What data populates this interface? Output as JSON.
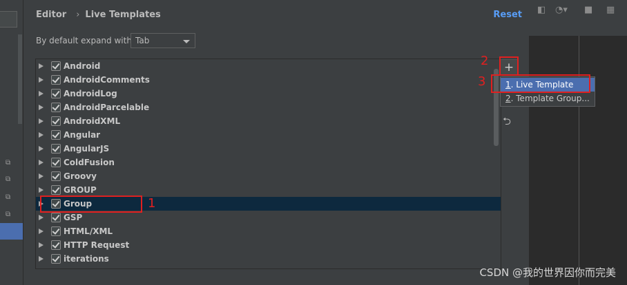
{
  "dialog": {
    "breadcrumb": [
      "Editor",
      "Live Templates"
    ],
    "reset_label": "Reset",
    "expand_label": "By default expand with",
    "expand_value": "Tab"
  },
  "groups": [
    "Android",
    "AndroidComments",
    "AndroidLog",
    "AndroidParcelable",
    "AndroidXML",
    "Angular",
    "AngularJS",
    "ColdFusion",
    "Groovy",
    "GROUP",
    "Group",
    "GSP",
    "HTML/XML",
    "HTTP Request",
    "iterations"
  ],
  "selected_group": "Group",
  "toolbar": {
    "add_icon": "plus-icon",
    "undo_icon": "undo-icon"
  },
  "add_menu": {
    "items": [
      "1. Live Template",
      "2. Template Group..."
    ],
    "highlighted_index": 0
  },
  "annotations": [
    "1",
    "2",
    "3"
  ],
  "watermark": "CSDN @我的世界因你而完美",
  "colors": {
    "selection": "#4b6eaf",
    "row_selected": "#0d293e",
    "link": "#589df6",
    "annotation": "#e02020"
  }
}
